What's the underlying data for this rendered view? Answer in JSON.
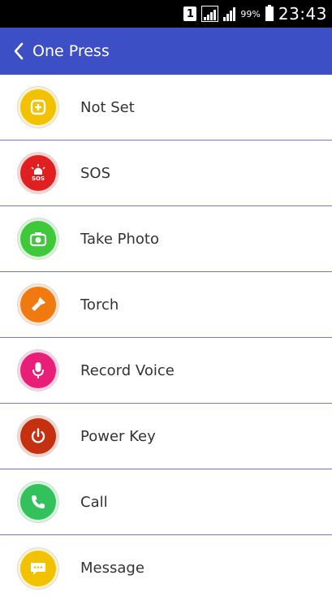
{
  "status_bar": {
    "sim": "1",
    "battery_percent": "99%",
    "time": "23:43"
  },
  "app_bar": {
    "title": "One Press",
    "back_icon": "chevron-left-icon"
  },
  "items": [
    {
      "label": "Not Set",
      "icon": "plus-square-icon",
      "color": "#f2c200"
    },
    {
      "label": "SOS",
      "icon": "siren-icon",
      "color": "#e02020",
      "icon_text": "SOS"
    },
    {
      "label": "Take Photo",
      "icon": "camera-icon",
      "color": "#3ec83a"
    },
    {
      "label": "Torch",
      "icon": "flashlight-icon",
      "color": "#f07a10"
    },
    {
      "label": "Record Voice",
      "icon": "microphone-icon",
      "color": "#e81e78"
    },
    {
      "label": "Power Key",
      "icon": "power-icon",
      "color": "#c43010"
    },
    {
      "label": "Call",
      "icon": "phone-icon",
      "color": "#32c15a"
    },
    {
      "label": "Message",
      "icon": "chat-icon",
      "color": "#f2c200"
    }
  ],
  "colors": {
    "app_bar": "#3c4fc4",
    "divider": "#6f7bd1"
  }
}
